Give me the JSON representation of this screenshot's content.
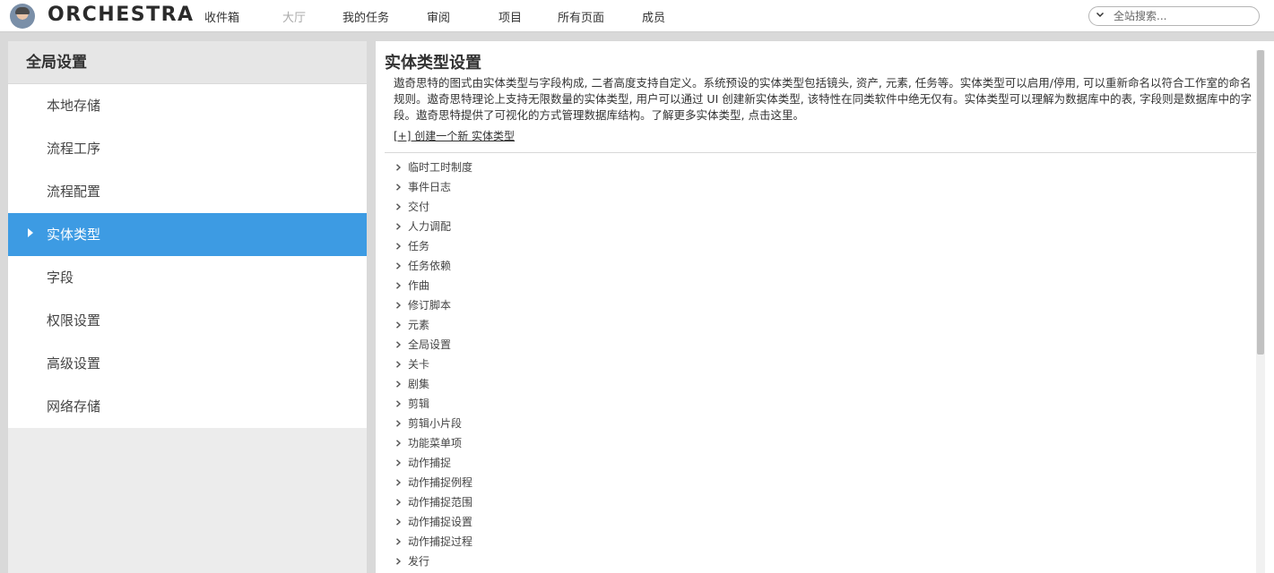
{
  "app": {
    "brand": "ORCHESTRA"
  },
  "nav": [
    {
      "label": "收件箱",
      "muted": false
    },
    {
      "label": "大厅",
      "muted": true
    },
    {
      "label": "我的任务",
      "muted": false
    },
    {
      "label": "审阅",
      "muted": false
    },
    {
      "label": "项目",
      "muted": false
    },
    {
      "label": "所有页面",
      "muted": false
    },
    {
      "label": "成员",
      "muted": false
    }
  ],
  "search": {
    "placeholder": "全站搜索..."
  },
  "sidebar": {
    "title": "全局设置",
    "items": [
      {
        "label": "本地存储"
      },
      {
        "label": "流程工序"
      },
      {
        "label": "流程配置"
      },
      {
        "label": "实体类型",
        "active": true
      },
      {
        "label": "字段"
      },
      {
        "label": "权限设置"
      },
      {
        "label": "高级设置"
      },
      {
        "label": "网络存储"
      }
    ]
  },
  "main": {
    "title": "实体类型设置",
    "description": "遨奇思特的图式由实体类型与字段构成, 二者高度支持自定义。系统预设的实体类型包括镜头, 资产, 元素, 任务等。实体类型可以启用/停用, 可以重新命名以符合工作室的命名规则。遨奇思特理论上支持无限数量的实体类型, 用户可以通过 UI 创建新实体类型, 该特性在同类软件中绝无仅有。实体类型可以理解为数据库中的表, 字段则是数据库中的字段。遨奇思特提供了可视化的方式管理数据库结构。了解更多实体类型, 点击这里。",
    "create_link": "[+] 创建一个新 实体类型",
    "entity_types": [
      "临时工时制度",
      "事件日志",
      "交付",
      "人力调配",
      "任务",
      "任务依赖",
      "作曲",
      "修订脚本",
      "元素",
      "全局设置",
      "关卡",
      "剧集",
      "剪辑",
      "剪辑小片段",
      "功能菜单项",
      "动作捕捉",
      "动作捕捉例程",
      "动作捕捉范围",
      "动作捕捉设置",
      "动作捕捉过程",
      "发行"
    ]
  },
  "colors": {
    "accent": "#3d9be3",
    "background": "#d9d9d9"
  }
}
